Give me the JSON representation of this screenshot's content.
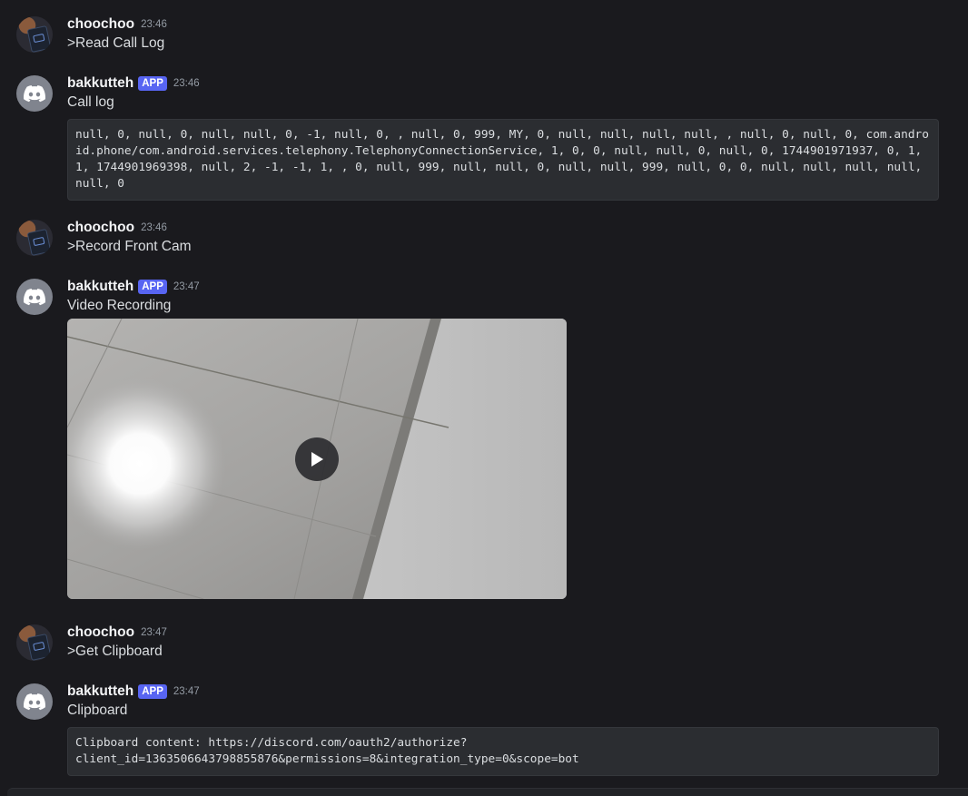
{
  "messages": [
    {
      "author": "choochoo",
      "time": "23:46",
      "text": ">Read Call Log"
    },
    {
      "author": "bakkutteh",
      "badge": "APP",
      "time": "23:46",
      "text": "Call log",
      "code": "null, 0, null, 0, null, null, 0, -1, null, 0, , null, 0, 999, MY, 0, null, null, null, null, , null, 0, null, 0, com.android.phone/com.android.services.telephony.TelephonyConnectionService, 1, 0, 0, null, null, 0, null, 0, 1744901971937, 0, 1, 1, 1744901969398, null, 2, -1, -1, 1, , 0, null, 999, null, null, 0, null, null, 999, null, 0, 0, null, null, null, null, null, 0"
    },
    {
      "author": "choochoo",
      "time": "23:46",
      "text": ">Record Front Cam"
    },
    {
      "author": "bakkutteh",
      "badge": "APP",
      "time": "23:47",
      "text": "Video Recording"
    },
    {
      "author": "choochoo",
      "time": "23:47",
      "text": ">Get Clipboard"
    },
    {
      "author": "bakkutteh",
      "badge": "APP",
      "time": "23:47",
      "text": "Clipboard",
      "code": "Clipboard content: https://discord.com/oauth2/authorize?\nclient_id=1363506643798855876&permissions=8&integration_type=0&scope=bot"
    }
  ],
  "icons": {
    "bot_avatar": "discord-logo-icon",
    "video_play": "play-icon"
  },
  "colors": {
    "background": "#1a1a1e",
    "badge": "#5865f2",
    "code_bg": "#2b2d31",
    "bot_avatar": "#80848e"
  }
}
